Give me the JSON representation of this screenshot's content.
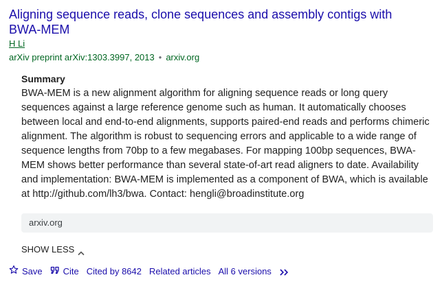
{
  "result": {
    "title": "Aligning sequence reads, clone sequences and assembly contigs with BWA-MEM",
    "author": "H Li",
    "venue": "arXiv preprint arXiv:1303.3997, 2013",
    "separator": "•",
    "domain": "arxiv.org"
  },
  "summary": {
    "heading": "Summary",
    "body": "BWA-MEM is a new alignment algorithm for aligning sequence reads or long query sequences against a large reference genome such as human. It automatically chooses between local and end-to-end alignments, supports paired-end reads and performs chimeric alignment. The algorithm is robust to sequencing errors and applicable to a wide range of sequence lengths from 70bp to a few megabases. For mapping 100bp sequences, BWA-MEM shows better performance than several state-of-art read aligners to date. Availability and implementation: BWA-MEM is implemented as a component of BWA, which is available at http://github.com/lh3/bwa. Contact: hengli@broadinstitute.org"
  },
  "source_box": {
    "label": "arxiv.org"
  },
  "show_less": {
    "label": "SHOW LESS",
    "icon": "chevron-up-icon"
  },
  "actions": {
    "save_label": "Save",
    "save_icon": "star-icon",
    "cite_label": "Cite",
    "cite_icon": "quote-icon",
    "cited_by_label": "Cited by 8642",
    "related_label": "Related articles",
    "versions_label": "All 6 versions",
    "more_icon": "double-chevron-right-icon"
  },
  "colors": {
    "link": "#1a0dab",
    "green": "#006621",
    "text": "#222222",
    "box_bg": "#f1f3f4"
  }
}
